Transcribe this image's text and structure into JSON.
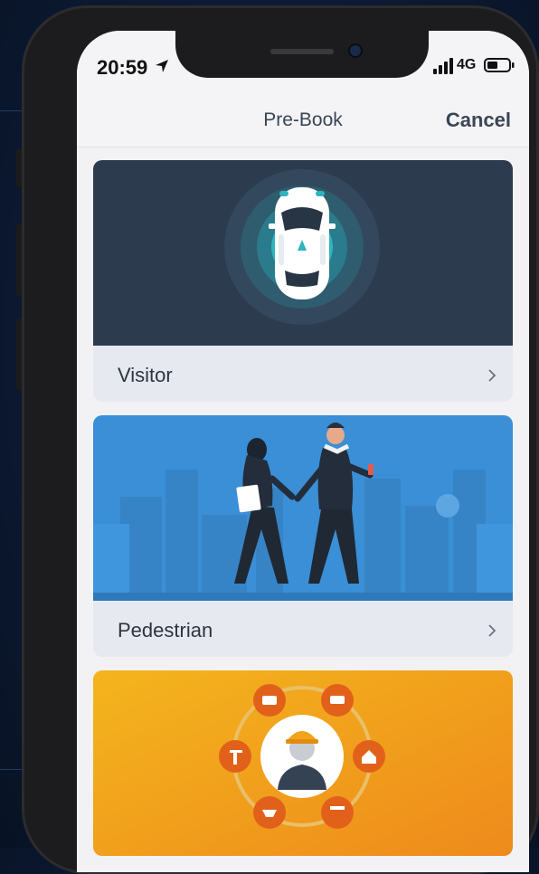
{
  "status_bar": {
    "time": "20:59",
    "network": "4G",
    "location_icon": "location-arrow-icon",
    "signal_icon": "signal-bars-icon",
    "battery_icon": "battery-icon"
  },
  "nav": {
    "title": "Pre-Book",
    "cancel_label": "Cancel"
  },
  "cards": [
    {
      "label": "Visitor",
      "icon": "car-top-view-illustration"
    },
    {
      "label": "Pedestrian",
      "icon": "walking-couple-illustration"
    },
    {
      "label": "",
      "icon": "contractor-tools-illustration"
    }
  ],
  "colors": {
    "visitor_bg": "#2d3b4e",
    "pedestrian_bg": "#3a8fd6",
    "contractor_bg": "#f2a31c",
    "nav_text": "#3b4556"
  }
}
